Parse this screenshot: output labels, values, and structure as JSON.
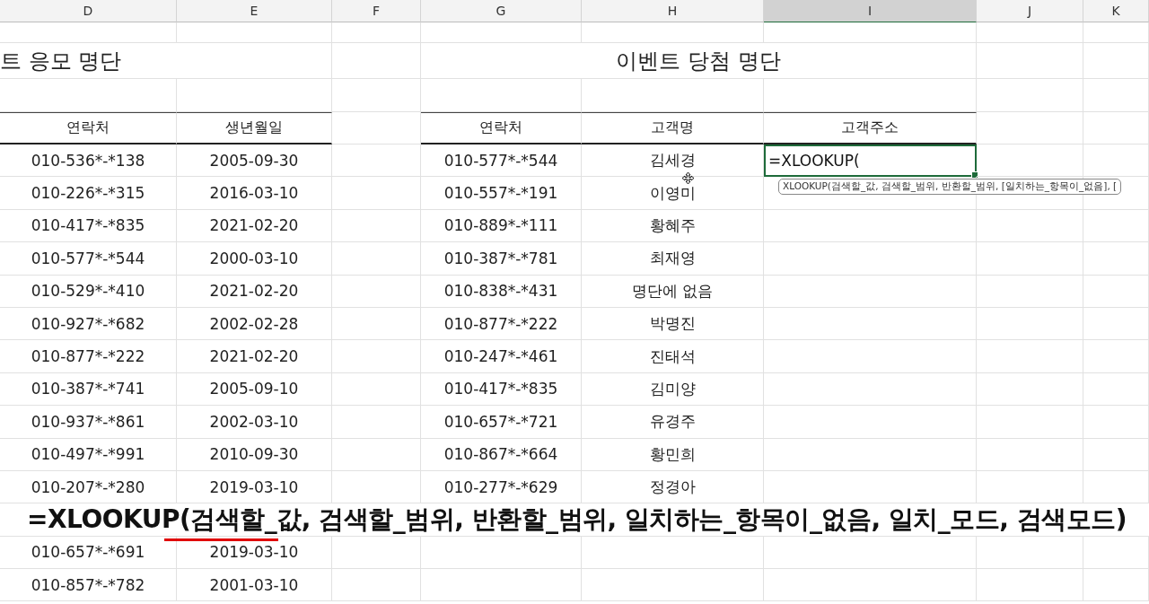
{
  "column_headers": [
    {
      "label": "D",
      "selected": false
    },
    {
      "label": "E",
      "selected": false
    },
    {
      "label": "F",
      "selected": false
    },
    {
      "label": "G",
      "selected": false
    },
    {
      "label": "H",
      "selected": false
    },
    {
      "label": "I",
      "selected": true
    },
    {
      "label": "J",
      "selected": false
    },
    {
      "label": "K",
      "selected": false
    }
  ],
  "entry_table": {
    "title": "트 응모 명단",
    "columns": [
      "연락처",
      "생년월일"
    ],
    "rows": [
      [
        "010-536*-*138",
        "2005-09-30"
      ],
      [
        "010-226*-*315",
        "2016-03-10"
      ],
      [
        "010-417*-*835",
        "2021-02-20"
      ],
      [
        "010-577*-*544",
        "2000-03-10"
      ],
      [
        "010-529*-*410",
        "2021-02-20"
      ],
      [
        "010-927*-*682",
        "2002-02-28"
      ],
      [
        "010-877*-*222",
        "2021-02-20"
      ],
      [
        "010-387*-*741",
        "2005-09-10"
      ],
      [
        "010-937*-*861",
        "2002-03-10"
      ],
      [
        "010-497*-*991",
        "2010-09-30"
      ],
      [
        "010-207*-*280",
        "2019-03-10"
      ],
      null,
      [
        "010-657*-*691",
        "2019-03-10"
      ],
      [
        "010-857*-*782",
        "2001-03-10"
      ]
    ]
  },
  "winner_table": {
    "title": "이벤트 당첨 명단",
    "columns": [
      "연락처",
      "고객명",
      "고객주소"
    ],
    "rows": [
      [
        "010-577*-*544",
        "김세경"
      ],
      [
        "010-557*-*191",
        "이영미"
      ],
      [
        "010-889*-*111",
        "황혜주"
      ],
      [
        "010-387*-*781",
        "최재영"
      ],
      [
        "010-838*-*431",
        "명단에 없음"
      ],
      [
        "010-877*-*222",
        "박명진"
      ],
      [
        "010-247*-*461",
        "진태석"
      ],
      [
        "010-417*-*835",
        "김미양"
      ],
      [
        "010-657*-*721",
        "유경주"
      ],
      [
        "010-867*-*664",
        "황민희"
      ],
      [
        "010-277*-*629",
        "정경아"
      ]
    ]
  },
  "active_cell": {
    "value": "=XLOOKUP(",
    "tooltip": "XLOOKUP(검색할_값, 검색할_범위, 반환할_범위, [일치하는_항목이_없음], ["
  },
  "caption": "=XLOOKUP(검색할_값, 검색할_범위, 반환할_범위, 일치하는_항목이_없음, 일치_모드, 검색모드)"
}
